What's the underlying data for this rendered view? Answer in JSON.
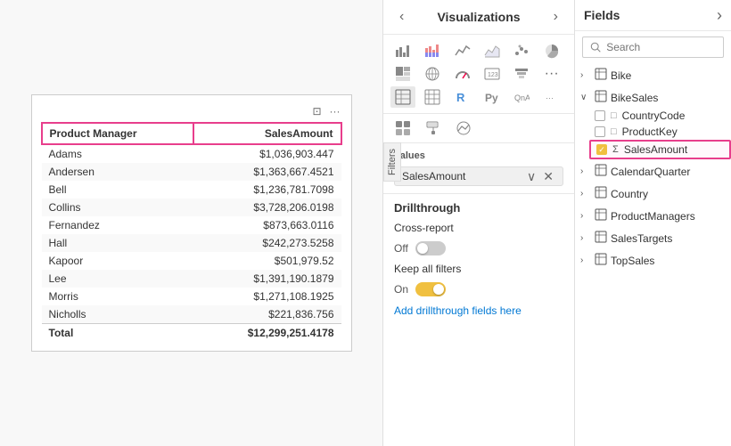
{
  "leftPanel": {
    "tableHeaders": [
      "Product Manager",
      "SalesAmount"
    ],
    "tableRows": [
      {
        "manager": "Adams",
        "amount": "$1,036,903.447"
      },
      {
        "manager": "Andersen",
        "amount": "$1,363,667.4521"
      },
      {
        "manager": "Bell",
        "amount": "$1,236,781.7098"
      },
      {
        "manager": "Collins",
        "amount": "$3,728,206.0198"
      },
      {
        "manager": "Fernandez",
        "amount": "$873,663.0116"
      },
      {
        "manager": "Hall",
        "amount": "$242,273.5258"
      },
      {
        "manager": "Kapoor",
        "amount": "$501,979.52"
      },
      {
        "manager": "Lee",
        "amount": "$1,391,190.1879"
      },
      {
        "manager": "Morris",
        "amount": "$1,271,108.1925"
      },
      {
        "manager": "Nicholls",
        "amount": "$221,836.756"
      }
    ],
    "totalLabel": "Total",
    "totalAmount": "$12,299,251.4178"
  },
  "middlePanel": {
    "title": "Visualizations",
    "filtersLabel": "Filters",
    "valuesLabel": "Values",
    "fieldPill": "SalesAmount",
    "drillthroughTitle": "Drillthrough",
    "crossReportLabel": "Cross-report",
    "crossReportState": "Off",
    "keepAllFiltersLabel": "Keep all filters",
    "keepAllFiltersState": "On",
    "addDrillthroughLabel": "Add drillthrough fields here"
  },
  "rightPanel": {
    "title": "Fields",
    "searchPlaceholder": "Search",
    "groups": [
      {
        "name": "Bike",
        "icon": "table",
        "expanded": false,
        "items": []
      },
      {
        "name": "BikeSales",
        "icon": "table",
        "expanded": true,
        "items": [
          {
            "name": "CountryCode",
            "type": "field",
            "checked": false,
            "highlighted": false
          },
          {
            "name": "ProductKey",
            "type": "field",
            "checked": false,
            "highlighted": false
          },
          {
            "name": "SalesAmount",
            "type": "sigma",
            "checked": true,
            "highlighted": true
          }
        ]
      },
      {
        "name": "CalendarQuarter",
        "icon": "table",
        "expanded": false,
        "items": []
      },
      {
        "name": "Country",
        "icon": "table",
        "expanded": false,
        "items": []
      },
      {
        "name": "ProductManagers",
        "icon": "table",
        "expanded": false,
        "items": []
      },
      {
        "name": "SalesTargets",
        "icon": "table",
        "expanded": false,
        "items": []
      },
      {
        "name": "TopSales",
        "icon": "table",
        "expanded": false,
        "items": []
      }
    ]
  }
}
